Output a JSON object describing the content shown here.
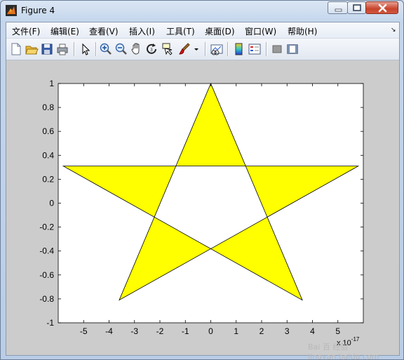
{
  "window": {
    "title": "Figure 4",
    "icon": "matlab-icon"
  },
  "menu": {
    "items": [
      "文件(F)",
      "编辑(E)",
      "查看(V)",
      "插入(I)",
      "工具(T)",
      "桌面(D)",
      "窗口(W)",
      "帮助(H)"
    ],
    "overflow_icon": "menu-collapse-icon"
  },
  "toolbar": {
    "icons": [
      "new-figure-icon",
      "open-file-icon",
      "save-icon",
      "print-icon",
      "edit-plot-arrow-icon",
      "zoom-in-icon",
      "zoom-out-icon",
      "pan-hand-icon",
      "rotate-3d-icon",
      "data-cursor-icon",
      "brush-icon",
      "link-plot-icon",
      "colorbar-icon",
      "legend-icon",
      "hide-plot-tools-icon",
      "show-plot-tools-icon"
    ]
  },
  "colors": {
    "fill": "#ffff00",
    "edge": "#000000",
    "axes_bg": "#ffffff",
    "figure_bg": "#cccccc"
  },
  "chart_data": {
    "type": "area",
    "title": "",
    "xlabel": "",
    "ylabel": "",
    "x_exponent_label": "x 10^-17",
    "xlim": [
      -6,
      6
    ],
    "ylim": [
      -1,
      1
    ],
    "xticks": [
      "-5",
      "-4",
      "-3",
      "-2",
      "-1",
      "0",
      "1",
      "2",
      "3",
      "4",
      "5"
    ],
    "yticks": [
      "1",
      "0.8",
      "0.6",
      "0.4",
      "0.2",
      "0",
      "-0.2",
      "-0.4",
      "-0.6",
      "-0.8",
      "-1"
    ],
    "series": [
      {
        "x": [
          0,
          3.6,
          -5.8,
          5.8,
          -3.6,
          0
        ],
        "y": [
          1,
          -0.81,
          0.31,
          0.31,
          -0.81,
          1
        ]
      }
    ]
  },
  "watermark": {
    "text": "Bai 百 经验",
    "url": "jingyan.baidu.com"
  }
}
